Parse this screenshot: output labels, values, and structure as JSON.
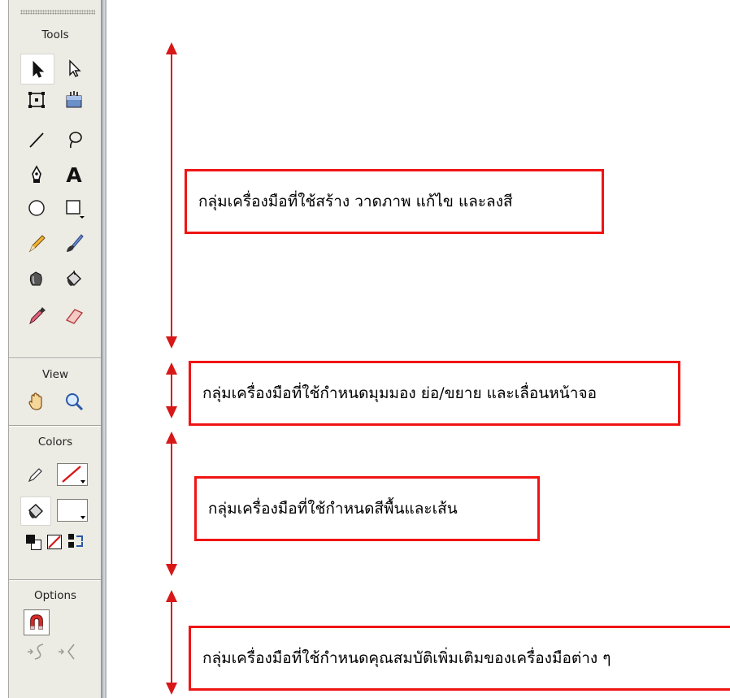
{
  "panel": {
    "sections": {
      "tools": "Tools",
      "view": "View",
      "colors": "Colors",
      "options": "Options"
    },
    "tool_icons": [
      "selection-arrow-icon",
      "subselection-arrow-icon",
      "free-transform-icon",
      "gradient-transform-icon",
      "line-icon",
      "lasso-icon",
      "pen-icon",
      "text-icon",
      "oval-icon",
      "rectangle-icon",
      "pencil-icon",
      "brush-icon",
      "ink-bottle-icon",
      "paint-bucket-icon",
      "eyedropper-icon",
      "eraser-icon"
    ],
    "text_tool_glyph": "A",
    "selected_tool": "selection-arrow-icon",
    "view_icons": [
      "hand-icon",
      "zoom-icon"
    ],
    "colors": {
      "stroke_color": "none (red slash)",
      "fill_color": "#ffffff"
    },
    "options_icons": [
      "snap-to-objects-icon",
      "smooth-icon",
      "straighten-icon"
    ]
  },
  "annotations": [
    {
      "label": "กลุ่มเครื่องมือที่ใช้สร้าง วาดภาพ แก้ไข และลงสี"
    },
    {
      "label": "กลุ่มเครื่องมือที่ใช้กำหนดมุมมอง ย่อ/ขยาย และเลื่อนหน้าจอ"
    },
    {
      "label": "กลุ่มเครื่องมือที่ใช้กำหนดสีพื้นและเส้น"
    },
    {
      "label": "กลุ่มเครื่องมือที่ใช้กำหนดคุณสมบัติเพิ่มเติมของเครื่องมือต่าง ๆ"
    }
  ],
  "accent_color": "#d81818",
  "box_border_color": "#f01414"
}
